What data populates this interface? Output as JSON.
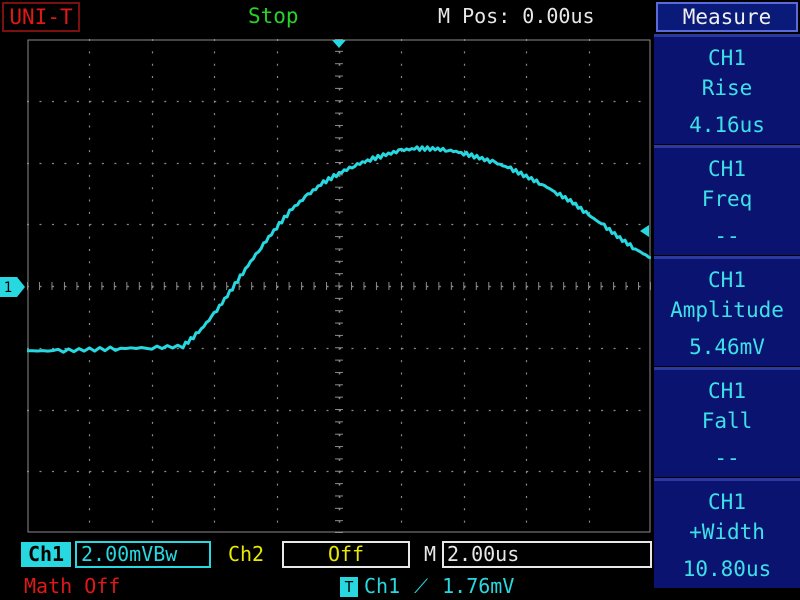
{
  "brand": "UNI-T",
  "status": "Stop",
  "m_pos": "M Pos: 0.00us",
  "panel": {
    "header": "Measure",
    "items": [
      {
        "channel": "CH1",
        "name": "Rise",
        "value": "4.16us"
      },
      {
        "channel": "CH1",
        "name": "Freq",
        "value": "--"
      },
      {
        "channel": "CH1",
        "name": "Amplitude",
        "value": "5.46mV"
      },
      {
        "channel": "CH1",
        "name": "Fall",
        "value": "--"
      },
      {
        "channel": "CH1",
        "name": "+Width",
        "value": "10.80us"
      }
    ]
  },
  "bottom": {
    "ch1_label": "Ch1",
    "ch1_scale": "2.00mVBw",
    "ch2_label": "Ch2",
    "ch2_state": "Off",
    "m_label": "M",
    "timebase": "2.00us",
    "math": "Math Off",
    "trigger": {
      "icon": "T",
      "source": "Ch1",
      "slope": "⟋",
      "level": "1.76mV"
    }
  },
  "screen": {
    "channel_marker": "1",
    "divisions": {
      "x": 10,
      "y": 8
    },
    "trace_color": "#28d8e0"
  },
  "chart_data": {
    "type": "line",
    "title": "",
    "xlabel": "",
    "ylabel": "",
    "x_unit": "us",
    "y_unit": "mV",
    "xlim": [
      -10,
      10
    ],
    "ylim": [
      -8,
      8
    ],
    "series": [
      {
        "x": [
          -10,
          -9,
          -8,
          -7,
          -6,
          -5,
          -4.5,
          -4,
          -3.5,
          -3,
          -2.5,
          -2,
          -1.5,
          -1,
          -0.5,
          0,
          0.5,
          1,
          1.5,
          2,
          2.5,
          3,
          3.5,
          4,
          4.5,
          5,
          5.5,
          6,
          6.5,
          7,
          7.5,
          8,
          8.5,
          9,
          9.5,
          10
        ],
        "values": [
          -2.1,
          -2.1,
          -2.06,
          -2.02,
          -2.0,
          -1.95,
          -1.5,
          -0.9,
          -0.2,
          0.55,
          1.25,
          1.9,
          2.5,
          2.95,
          3.35,
          3.65,
          3.9,
          4.1,
          4.25,
          4.4,
          4.45,
          4.45,
          4.4,
          4.3,
          4.15,
          4.0,
          3.8,
          3.55,
          3.3,
          3.0,
          2.7,
          2.3,
          1.95,
          1.55,
          1.2,
          0.9
        ]
      }
    ]
  }
}
